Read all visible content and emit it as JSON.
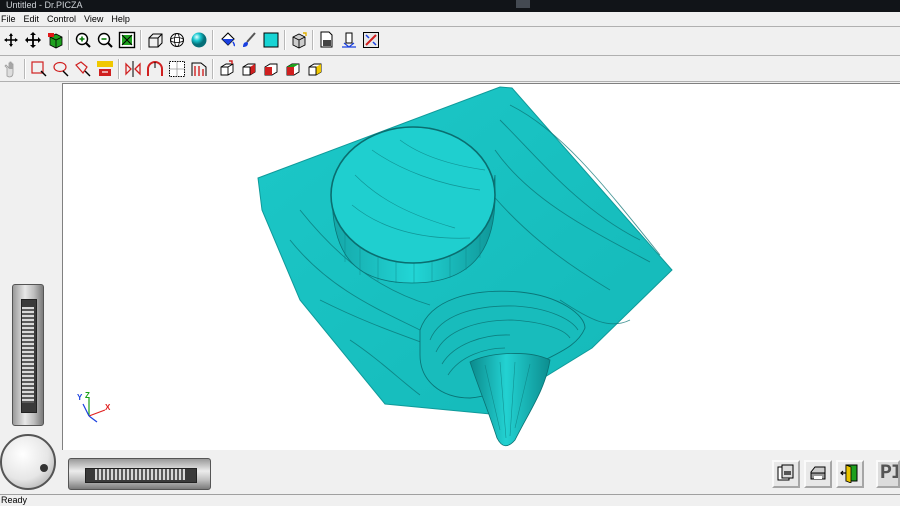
{
  "window": {
    "title": "Untitled - Dr.PICZA"
  },
  "menu": {
    "items": [
      "File",
      "Edit",
      "Control",
      "View",
      "Help"
    ]
  },
  "toolbar1": {
    "icons": [
      "rotate-arrows-icon",
      "move-cross-icon",
      "cube-color-icon",
      "zoom-in-icon",
      "zoom-out-icon",
      "zoom-fit-icon",
      "wireframe-cube-icon",
      "wireframe-sphere-icon",
      "shaded-sphere-icon",
      "fill-bucket-icon",
      "brush-icon",
      "color-swatch-icon",
      "solid-cube-icon",
      "scan-doc-icon",
      "scan-tower-icon",
      "settings-grid-icon"
    ]
  },
  "toolbar2": {
    "icons": [
      "hand-icon",
      "select-rect-icon",
      "select-lasso-icon",
      "select-polygon-icon",
      "scale-icon",
      "mirror-icon",
      "arch-icon",
      "grid-box-icon",
      "slice-icon",
      "cube-view-1-icon",
      "cube-view-2-icon",
      "cube-view-3-icon",
      "cube-view-4-icon",
      "cube-view-5-icon"
    ]
  },
  "model": {
    "color": "#17c4c4",
    "shadow_color": "#0a7f80"
  },
  "axes": {
    "x_label": "X",
    "y_label": "Y",
    "z_label": "Z"
  },
  "bottom_buttons": [
    "print-preview-icon",
    "printer-icon",
    "exit-door-icon"
  ],
  "brand_tab": {
    "label": "PI"
  },
  "status": {
    "text": "Ready"
  },
  "colors": {
    "accent_cyan": "#17c4c4",
    "axis_x": "#e02020",
    "axis_y": "#1a40e0",
    "axis_z": "#18a018"
  }
}
